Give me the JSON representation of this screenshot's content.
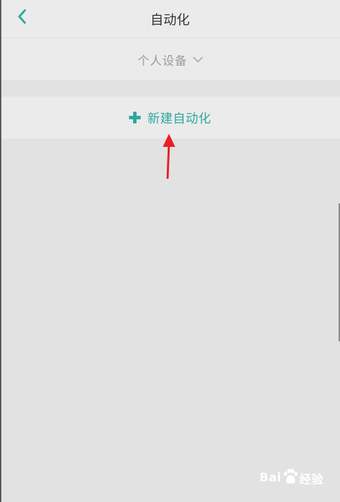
{
  "header": {
    "title": "自动化",
    "back_icon": "chevron-left-icon"
  },
  "device_selector": {
    "label": "个人设备",
    "icon": "chevron-down-icon"
  },
  "new_automation": {
    "label": "新建自动化",
    "icon": "plus-icon"
  },
  "watermark": {
    "brand_left": "Bai",
    "brand_right": "经验",
    "paw_icon": "baidu-paw-icon"
  },
  "colors": {
    "accent": "#2fa7a0",
    "background": "#e2e2e2",
    "panel": "#ebebeb",
    "title_text": "#333333",
    "muted_text": "#9a9a9a",
    "annotation_arrow": "#e81f26"
  }
}
